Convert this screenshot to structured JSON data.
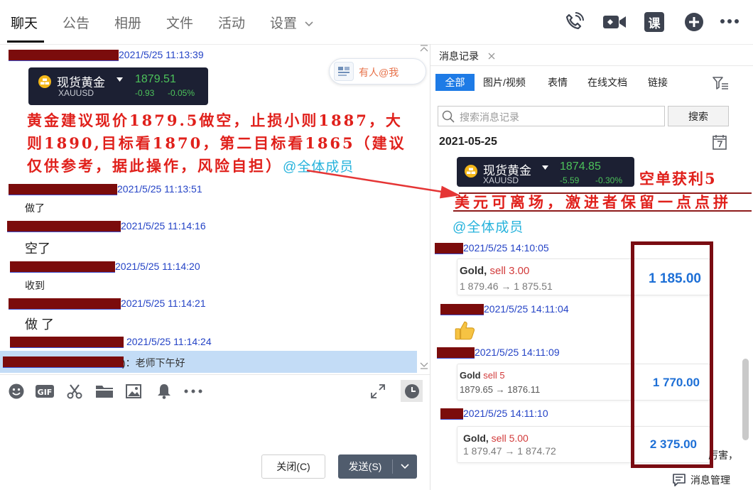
{
  "colors": {
    "accent": "#1e7be6",
    "timestamp": "#2443c6",
    "annotation_red": "#e0201b",
    "mention_cyan": "#27b3dc",
    "price_green": "#4cc25a",
    "profit_blue": "#1d6fd6",
    "redaction": "#7b0c0c",
    "highlight_box": "#7a0c12"
  },
  "header": {
    "tabs": [
      {
        "label": "聊天"
      },
      {
        "label": "公告"
      },
      {
        "label": "相册"
      },
      {
        "label": "文件"
      },
      {
        "label": "活动"
      },
      {
        "label": "设置"
      }
    ],
    "active_tab_index": 0,
    "settings_icon": "chevron-down-icon",
    "actions": {
      "call_icon": "phone-icon",
      "video_icon": "video-camera-icon",
      "course_label": "课",
      "add_icon": "plus-circle-icon",
      "more_icon": "more-icon"
    }
  },
  "chat": {
    "mention_badge": "有人@我",
    "messages": [
      {
        "time": "2021/5/25 11:13:39",
        "quote": {
          "name": "现货黄金",
          "price": "1879.51",
          "symbol": "XAUUSD",
          "change": "-0.93",
          "change_pct": "-0.05%"
        },
        "lines": [
          "黄金建议现价1879.5做空，止损小则1887，大",
          "则1890,目标看1870，第二目标看1865（建议",
          "仅供参考，据此操作，风险自担）"
        ],
        "mention": "@全体成员"
      },
      {
        "time": "2021/5/25 11:13:51",
        "text": "做了"
      },
      {
        "time": "2021/5/25 11:14:16",
        "text": "空了"
      },
      {
        "time": "2021/5/25 11:14:20",
        "text": "收到"
      },
      {
        "time": "2021/5/25 11:14:21",
        "text": "做了"
      },
      {
        "time": "2021/5/25 11:14:24"
      }
    ],
    "highlighted_preview": ")：老师下午好"
  },
  "composer": {
    "toolbar_icons": [
      "emoji-icon",
      "gif-icon",
      "scissors-icon",
      "folder-icon",
      "image-icon",
      "bell-icon",
      "more-icon",
      "expand-icon",
      "history-clock-icon"
    ],
    "gif_label": "GIF",
    "close_label": "关闭(C)",
    "send_label": "发送(S)"
  },
  "history": {
    "tab_label": "消息记录",
    "filters": [
      {
        "label": "全部"
      },
      {
        "label": "图片/视频"
      },
      {
        "label": "表情"
      },
      {
        "label": "在线文档"
      },
      {
        "label": "链接"
      }
    ],
    "active_filter_index": 0,
    "search": {
      "placeholder": "搜索消息记录",
      "button": "搜索"
    },
    "date": "2021-05-25",
    "quote": {
      "name": "现货黄金",
      "price": "1874.85",
      "symbol": "XAUUSD",
      "change": "-5.59",
      "change_pct": "-0.30%"
    },
    "annotation": {
      "line1": "空单获利5",
      "line2": "美元可离场，激进者保留一点点拼",
      "mention": "@全体成员"
    },
    "entries": [
      {
        "time": "2021/5/25 14:10:05",
        "trade": {
          "symbol": "Gold,",
          "side": "sell 3.00",
          "prices": "1 879.46 → 1 875.51",
          "profit": "1 185.00"
        }
      },
      {
        "time": "2021/5/25 14:11:04",
        "emoji_icon": "thumbs-up-icon"
      },
      {
        "time": "2021/5/25 14:11:09",
        "trade": {
          "symbol": "Gold",
          "side": "sell 5",
          "prices": "1879.65 → 1876.11",
          "profit": "1 770.00"
        }
      },
      {
        "time": "2021/5/25 14:11:10",
        "trade": {
          "symbol": "Gold,",
          "side": "sell 5.00",
          "prices": "1 879.47 → 1 874.72",
          "profit": "2 375.00"
        }
      }
    ],
    "partial_text": "厉害，",
    "footer": {
      "label": "消息管理",
      "icon": "message-manage-icon"
    }
  }
}
